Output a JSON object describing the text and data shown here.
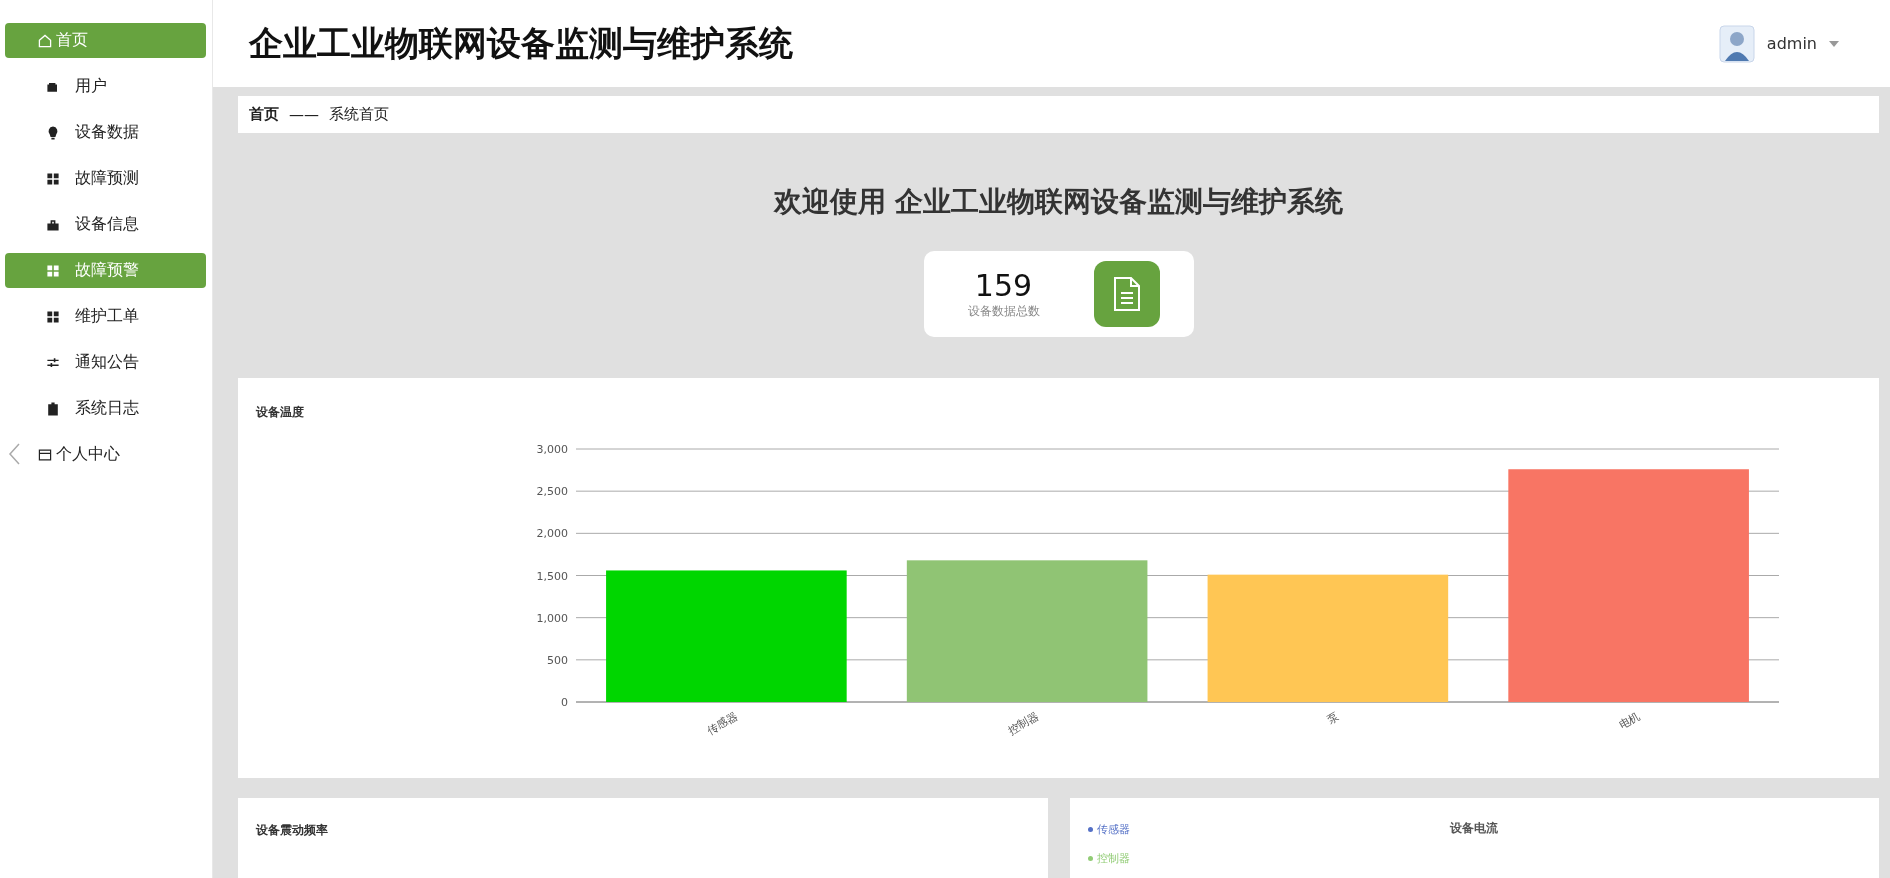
{
  "sidebar": {
    "items": [
      {
        "kind": "top",
        "label": "首页",
        "selected": true
      },
      {
        "kind": "sub",
        "label": "用户",
        "selected": false
      },
      {
        "kind": "sub",
        "label": "设备数据",
        "selected": false
      },
      {
        "kind": "sub",
        "label": "故障预测",
        "selected": false
      },
      {
        "kind": "sub",
        "label": "设备信息",
        "selected": false
      },
      {
        "kind": "sub",
        "label": "故障预警",
        "selected": true
      },
      {
        "kind": "sub",
        "label": "维护工单",
        "selected": false
      },
      {
        "kind": "sub",
        "label": "通知公告",
        "selected": false
      },
      {
        "kind": "sub",
        "label": "系统日志",
        "selected": false
      },
      {
        "kind": "top",
        "label": "个人中心",
        "selected": false
      }
    ]
  },
  "header": {
    "title": "企业工业物联网设备监测与维护系统",
    "user": "admin"
  },
  "breadcrumb": {
    "root": "首页",
    "separator": "——",
    "current": "系统首页"
  },
  "welcome": "欢迎使用 企业工业物联网设备监测与维护系统",
  "stat": {
    "value": "159",
    "label": "设备数据总数"
  },
  "temperature_panel": {
    "title": "设备温度",
    "chart_data": {
      "type": "bar",
      "categories": [
        "传感器",
        "控制器",
        "泵",
        "电机"
      ],
      "values": [
        1560,
        1680,
        1510,
        2760
      ],
      "colors": [
        "#00d600",
        "#90c474",
        "#ffc654",
        "#f87564"
      ],
      "grid": true,
      "ylim": [
        0,
        3000
      ],
      "yticks": [
        0,
        {
          "value": 500,
          "label": "500"
        },
        {
          "value": 1000,
          "label": "1,000"
        },
        {
          "value": 1500,
          "label": "1,500"
        },
        {
          "value": 2000,
          "label": "2,000"
        },
        {
          "value": 2500,
          "label": "2,500"
        },
        {
          "value": 3000,
          "label": "3,000"
        }
      ]
    }
  },
  "vibration_panel": {
    "title": "设备震动频率"
  },
  "current_panel": {
    "title": "设备电流",
    "legend": [
      {
        "label": "传感器",
        "color": "#5470c6"
      },
      {
        "label": "控制器",
        "color": "#91cc75"
      }
    ]
  }
}
